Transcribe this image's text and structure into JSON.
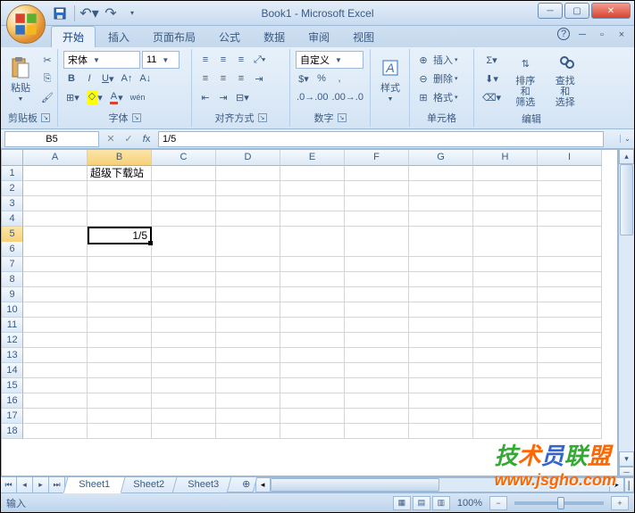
{
  "title": "Book1 - Microsoft Excel",
  "qat": {
    "save": "save-icon",
    "undo": "undo-icon",
    "redo": "redo-icon"
  },
  "tabs": [
    "开始",
    "插入",
    "页面布局",
    "公式",
    "数据",
    "审阅",
    "视图"
  ],
  "active_tab": 0,
  "ribbon": {
    "clipboard": {
      "label": "剪贴板",
      "paste": "粘贴"
    },
    "font": {
      "label": "字体",
      "name": "宋体",
      "size": "11"
    },
    "alignment": {
      "label": "对齐方式"
    },
    "number": {
      "label": "数字",
      "format": "自定义"
    },
    "styles": {
      "label": "样式",
      "btn": "样式"
    },
    "cells": {
      "label": "单元格",
      "insert": "插入",
      "delete": "删除",
      "format": "格式"
    },
    "editing": {
      "label": "编辑",
      "sort": "排序和\n筛选",
      "find": "查找和\n选择"
    }
  },
  "namebox": "B5",
  "formula": "1/5",
  "columns": [
    "A",
    "B",
    "C",
    "D",
    "E",
    "F",
    "G",
    "H",
    "I"
  ],
  "active_col": 1,
  "rows": 18,
  "active_row": 5,
  "cells": {
    "B1": "超级下载站",
    "B5": "1/5"
  },
  "selected": "B5",
  "sheets": [
    "Sheet1",
    "Sheet2",
    "Sheet3"
  ],
  "active_sheet": 0,
  "status": "输入",
  "zoom": "100%",
  "zoom_controls": {
    "minus": "−",
    "plus": "+"
  },
  "watermark": {
    "text1": "技",
    "text2": "术",
    "text3": "员",
    "text4": "联",
    "text5": "盟",
    "url": "www.jsgho.com"
  }
}
